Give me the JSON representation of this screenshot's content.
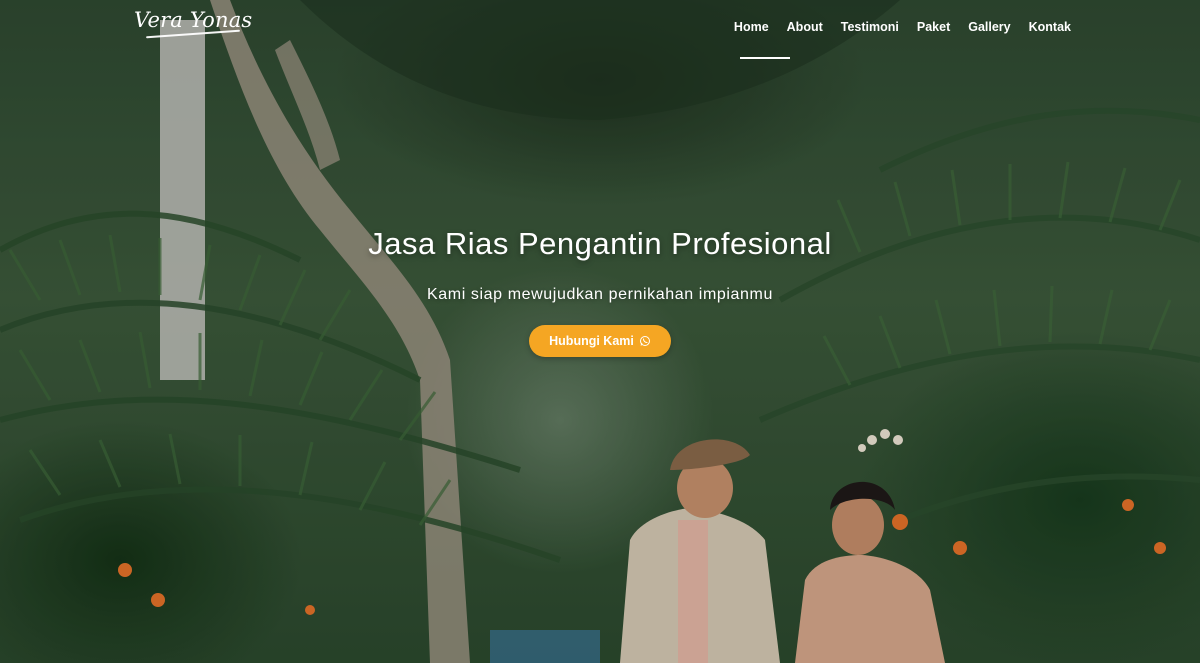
{
  "brand": {
    "logo_text": "Vera Yonas"
  },
  "nav": {
    "items": [
      {
        "label": "Home",
        "active": true
      },
      {
        "label": "About"
      },
      {
        "label": "Testimoni"
      },
      {
        "label": "Paket"
      },
      {
        "label": "Gallery"
      },
      {
        "label": "Kontak"
      }
    ]
  },
  "hero": {
    "title": "Jasa Rias Pengantin Profesional",
    "subtitle": "Kami siap mewujudkan pernikahan impianmu",
    "cta_label": "Hubungi Kami",
    "cta_icon": "whatsapp-icon",
    "background_image": "tropical-garden-wedding-couple-photo"
  },
  "colors": {
    "cta": "#f5a623",
    "text": "#ffffff",
    "foliage": "#2f4a32"
  }
}
